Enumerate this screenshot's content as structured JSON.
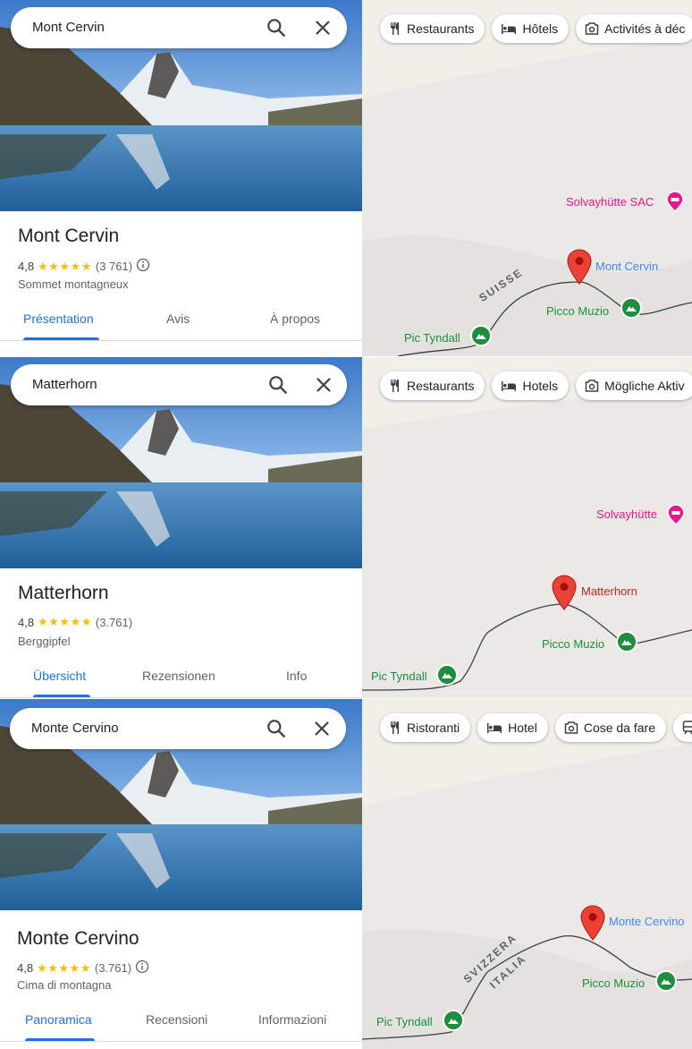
{
  "panels": [
    {
      "search": "Mont Cervin",
      "title": "Mont Cervin",
      "rating": "4,8",
      "stars": "★★★★★",
      "reviews": "(3 761)",
      "category": "Sommet montagneux",
      "tabs": [
        "Présentation",
        "Avis",
        "À propos"
      ],
      "chips": [
        "Restaurants",
        "Hôtels",
        "Activités à déc"
      ],
      "map": {
        "hut": "Solvayhütte SAC",
        "peak": "Mont Cervin",
        "muzio": "Picco Muzio",
        "tyndall": "Pic Tyndall",
        "border1": "SUISSE",
        "border2": ""
      }
    },
    {
      "search": "Matterhorn",
      "title": "Matterhorn",
      "rating": "4,8",
      "stars": "★★★★★",
      "reviews": "(3.761)",
      "category": "Berggipfel",
      "tabs": [
        "Übersicht",
        "Rezensionen",
        "Info"
      ],
      "chips": [
        "Restaurants",
        "Hotels",
        "Mögliche Aktiv"
      ],
      "map": {
        "hut": "Solvayhütte",
        "peak": "Matterhorn",
        "muzio": "Picco Muzio",
        "tyndall": "Pic Tyndall",
        "border1": "",
        "border2": ""
      }
    },
    {
      "search": "Monte Cervino",
      "title": "Monte Cervino",
      "rating": "4,8",
      "stars": "★★★★★",
      "reviews": "(3.761)",
      "category": "Cima di montagna",
      "tabs": [
        "Panoramica",
        "Recensioni",
        "Informazioni"
      ],
      "chips": [
        "Ristoranti",
        "Hotel",
        "Cose da fare"
      ],
      "map": {
        "hut": "",
        "peak": "Monte Cervino",
        "muzio": "Picco Muzio",
        "tyndall": "Pic Tyndall",
        "border1": "SVIZZERA",
        "border2": "ITALIA"
      }
    }
  ],
  "icons": {
    "search": "search-icon",
    "close": "close-icon",
    "info": "info-icon",
    "restaurant": "fork-knife-icon",
    "hotel": "bed-icon",
    "things": "camera-icon",
    "peak": "mountain-pin-icon",
    "hut": "hut-pin-icon",
    "place": "red-pin-icon"
  },
  "colors": {
    "accent": "#1a73e8",
    "star": "#fbbc04",
    "pin_red": "#ea4335",
    "peak_green": "#1e8e3e",
    "hut_pink": "#e8178c",
    "place_blue": "#4285f4",
    "place_red": "#c5221f"
  }
}
